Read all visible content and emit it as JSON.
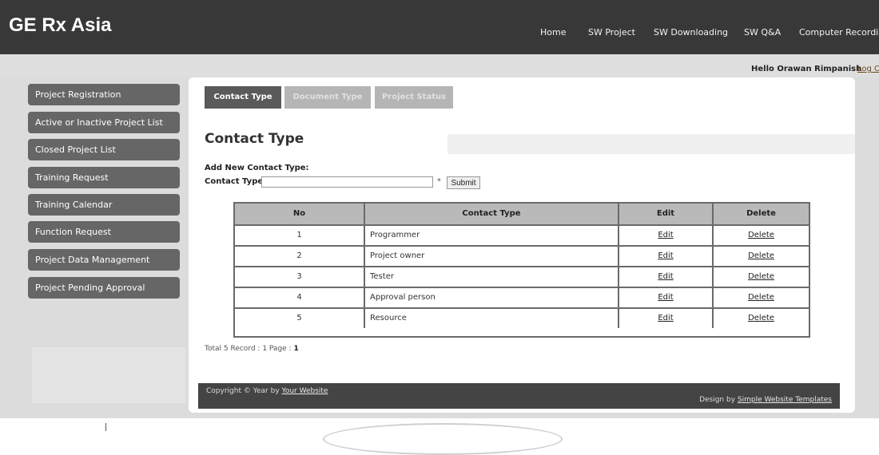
{
  "header": {
    "logo": "GE Rx Asia",
    "nav": [
      "Home",
      "SW Project",
      "SW Downloading",
      "SW Q&A",
      "Computer Recording"
    ]
  },
  "user": {
    "greeting": "Hello Orawan Rimpanish",
    "logout": "Log Ou"
  },
  "sidebar": {
    "items": [
      {
        "label": "Project Registration"
      },
      {
        "label": "Active or Inactive Project List"
      },
      {
        "label": "Closed Project List"
      },
      {
        "label": "Training Request"
      },
      {
        "label": "Training Calendar"
      },
      {
        "label": "Function Request"
      },
      {
        "label": "Project Data Management"
      },
      {
        "label": "Project Pending Approval"
      }
    ]
  },
  "tabs": [
    {
      "label": "Contact Type",
      "active": true
    },
    {
      "label": "Document Type",
      "active": false
    },
    {
      "label": "Project Status",
      "active": false
    }
  ],
  "main": {
    "title": "Contact Type",
    "add_label": "Add New Contact Type:",
    "field_label": "Contact Type:",
    "field_value": "",
    "required_marker": "*",
    "submit_label": "Submit"
  },
  "table": {
    "headers": [
      "No",
      "Contact Type",
      "Edit",
      "Delete"
    ],
    "rows": [
      {
        "no": "1",
        "type": "Programmer",
        "edit": "Edit",
        "delete": "Delete"
      },
      {
        "no": "2",
        "type": "Project owner",
        "edit": "Edit",
        "delete": "Delete"
      },
      {
        "no": "3",
        "type": "Tester",
        "edit": "Edit",
        "delete": "Delete"
      },
      {
        "no": "4",
        "type": "Approval person",
        "edit": "Edit",
        "delete": "Delete"
      },
      {
        "no": "5",
        "type": "Resource",
        "edit": "Edit",
        "delete": "Delete"
      }
    ]
  },
  "pagination": {
    "prefix": "Total 5 Record : 1 Page : ",
    "page": "1"
  },
  "footer": {
    "copyright_prefix": "Copyright © Year by ",
    "copyright_link": "Your Website",
    "design_prefix": "Design by ",
    "design_link": "Simple Website Templates"
  },
  "colors": {
    "header_bg": "#383838",
    "sidebar_bg": "#666666",
    "active_tab": "#5a5a5a",
    "inactive_tab": "#b5b5b5",
    "table_header": "#b9b9b9",
    "footer_bg": "#444444"
  }
}
